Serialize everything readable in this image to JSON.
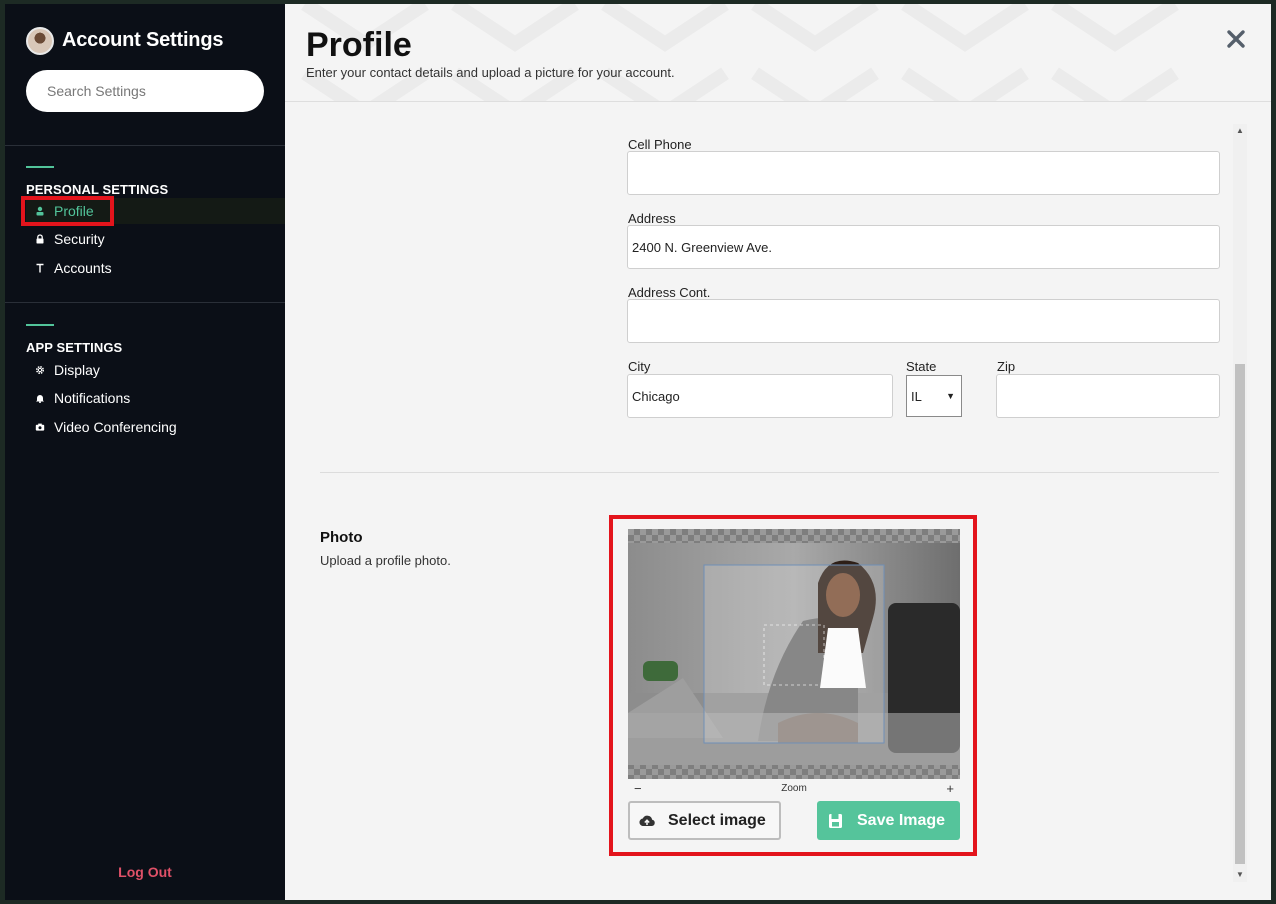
{
  "sidebar": {
    "title": "Account Settings",
    "search_placeholder": "Search Settings",
    "personal_section": "PERSONAL SETTINGS",
    "personal_items": [
      {
        "label": "Profile",
        "icon": "person-icon"
      },
      {
        "label": "Security",
        "icon": "lock-icon"
      },
      {
        "label": "Accounts",
        "icon": "accounts-icon"
      }
    ],
    "app_section": "APP SETTINGS",
    "app_items": [
      {
        "label": "Display",
        "icon": "gear-icon"
      },
      {
        "label": "Notifications",
        "icon": "bell-icon"
      },
      {
        "label": "Video Conferencing",
        "icon": "camera-icon"
      }
    ],
    "logout_label": "Log Out"
  },
  "header": {
    "title": "Profile",
    "subtitle": "Enter your contact details and upload a picture for your account."
  },
  "form": {
    "cell_phone": {
      "label": "Cell Phone",
      "value": ""
    },
    "address": {
      "label": "Address",
      "value": "2400 N. Greenview Ave."
    },
    "address_cont": {
      "label": "Address Cont.",
      "value": ""
    },
    "city": {
      "label": "City",
      "value": "Chicago"
    },
    "state": {
      "label": "State",
      "value": "IL"
    },
    "zip": {
      "label": "Zip",
      "value": ""
    }
  },
  "photo": {
    "title": "Photo",
    "subtitle": "Upload a profile photo.",
    "zoom_label": "Zoom",
    "zoom_minus": "−",
    "zoom_plus": "+",
    "select_label": "Select image",
    "save_label": "Save Image"
  },
  "colors": {
    "accent": "#52c49a",
    "sidebar_bg": "#0b0f17",
    "highlight": "#e3141c",
    "logout": "#e05168"
  }
}
